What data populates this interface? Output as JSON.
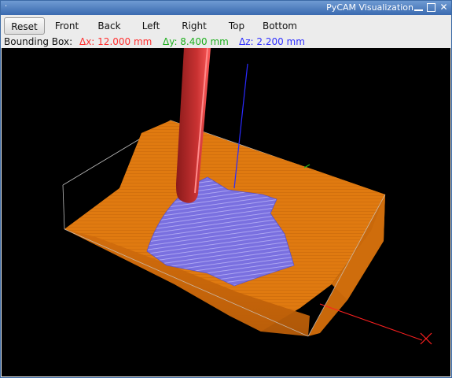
{
  "window": {
    "title": "PyCAM Visualization",
    "menu_glyph": "·"
  },
  "toolbar": {
    "buttons": [
      {
        "label": "Reset",
        "active": true
      },
      {
        "label": "Front"
      },
      {
        "label": "Back"
      },
      {
        "label": "Left"
      },
      {
        "label": "Right"
      },
      {
        "label": "Top"
      },
      {
        "label": "Bottom"
      }
    ]
  },
  "bounding_box": {
    "label": "Bounding Box:",
    "dx": "Δx: 12.000 mm",
    "dy": "Δy: 8.400 mm",
    "dz": "Δz: 2.200 mm",
    "colors": {
      "dx": "#ff3030",
      "dy": "#20c020",
      "dz": "#3030ff"
    }
  },
  "scene": {
    "colors": {
      "background": "#000000",
      "model": "#e07a10",
      "toolpath": "#7a70e0",
      "tool": "#c83030",
      "x_axis": "#ff2020",
      "y_axis": "#20c020",
      "z_axis": "#2020ff",
      "box": "#cccccc"
    }
  }
}
